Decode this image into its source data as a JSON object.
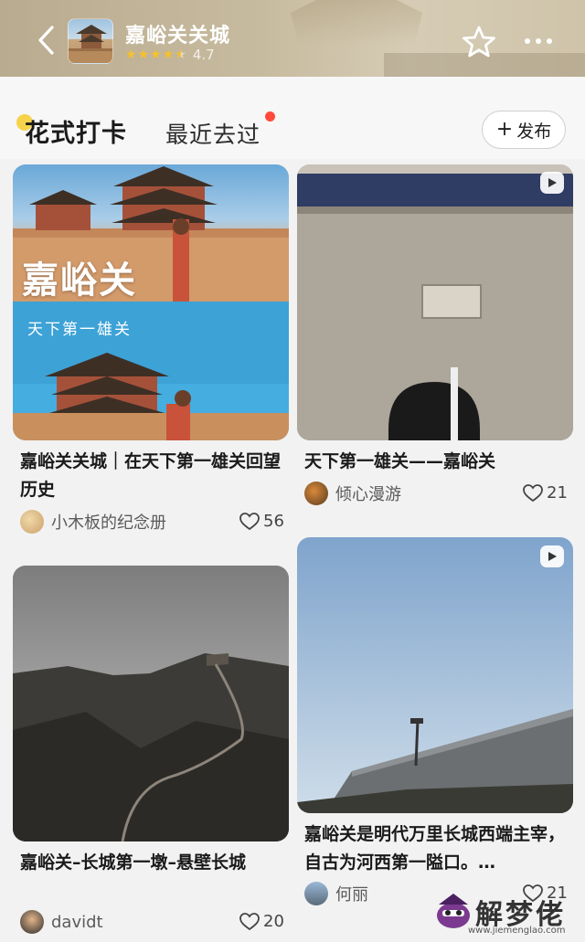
{
  "header": {
    "poi_name": "嘉峪关关城",
    "rating": "4.7",
    "rating_stars": 4.5,
    "icons": [
      "back-icon",
      "star-outline-icon",
      "more-icon"
    ]
  },
  "tabs": {
    "active": "花式打卡",
    "recent": "最近去过",
    "publish": "发布"
  },
  "cards": [
    {
      "title": "嘉峪关关城｜在天下第一雄关回望历史",
      "author": "小木板的纪念册",
      "likes": "56",
      "image_text": [
        "嘉峪关",
        "天下第一雄关"
      ],
      "video": false
    },
    {
      "title": "天下第一雄关——嘉峪关",
      "author": "倾心漫游",
      "likes": "21",
      "video": true
    },
    {
      "title": "嘉峪关–长城第一墩–悬壁长城",
      "author": "davidt",
      "likes": "20",
      "video": false
    },
    {
      "title": "嘉峪关是明代万里长城西端主宰，自古为河西第一隘口。…",
      "author": "何丽",
      "likes": "21",
      "video": true
    }
  ],
  "watermark": {
    "text": "解梦佬",
    "url": "www.jiemenglao.com"
  },
  "colors": {
    "star": "#f6c12a",
    "red_dot": "#ff4a3d"
  }
}
